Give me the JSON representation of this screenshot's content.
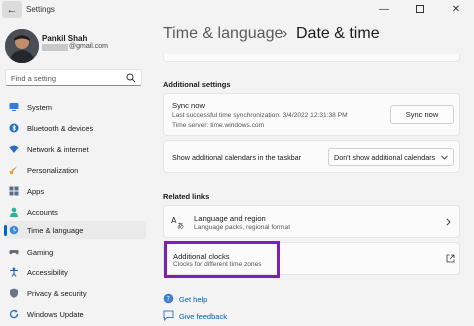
{
  "app": {
    "title": "Settings"
  },
  "window_controls": {
    "minimize": "—",
    "close": "✕"
  },
  "user": {
    "name": "Pankil Shah",
    "email_suffix": "@gmail.com"
  },
  "search": {
    "placeholder": "Find a setting"
  },
  "nav": {
    "items": [
      {
        "label": "System",
        "icon": "monitor-icon"
      },
      {
        "label": "Bluetooth & devices",
        "icon": "bluetooth-icon"
      },
      {
        "label": "Network & internet",
        "icon": "wifi-icon"
      },
      {
        "label": "Personalization",
        "icon": "brush-icon"
      },
      {
        "label": "Apps",
        "icon": "apps-icon"
      },
      {
        "label": "Accounts",
        "icon": "person-icon"
      },
      {
        "label": "Time & language",
        "icon": "globe-clock-icon",
        "active": true
      },
      {
        "label": "Gaming",
        "icon": "gamepad-icon"
      },
      {
        "label": "Accessibility",
        "icon": "accessibility-icon"
      },
      {
        "label": "Privacy & security",
        "icon": "shield-icon"
      },
      {
        "label": "Windows Update",
        "icon": "update-icon"
      }
    ],
    "accent": "#0067c0"
  },
  "breadcrumb": {
    "parent": "Time & language",
    "separator": "›",
    "current": "Date & time"
  },
  "additional_settings": {
    "heading": "Additional settings",
    "sync": {
      "title": "Sync now",
      "last_sync": "Last successful time synchronization: 3/4/2022 12:31:38 PM",
      "server": "Time server: time.windows.com",
      "button": "Sync now"
    },
    "calendar": {
      "label": "Show additional calendars in the taskbar",
      "selected": "Don't show additional calendars"
    }
  },
  "related_links": {
    "heading": "Related links",
    "language_region": {
      "title": "Language and region",
      "subtitle": "Language packs, regional format"
    },
    "additional_clocks": {
      "title": "Additional clocks",
      "subtitle": "Clocks for different time zones"
    },
    "highlight_color": "#7b22b6"
  },
  "help": {
    "get_help": "Get help",
    "give_feedback": "Give feedback"
  }
}
